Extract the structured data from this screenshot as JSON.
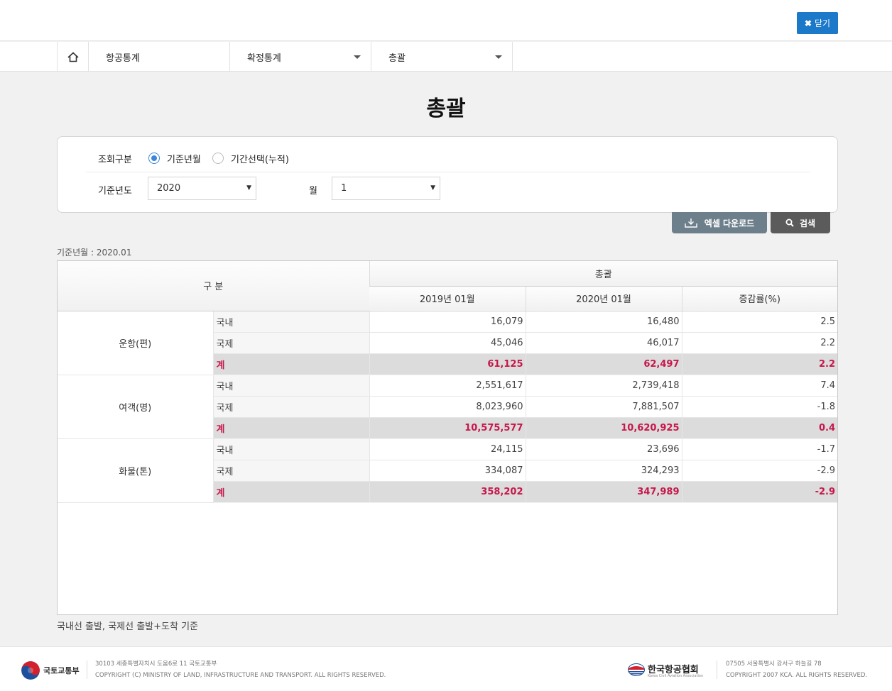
{
  "header": {
    "close_label": "닫기"
  },
  "nav": {
    "home_icon": "home-icon",
    "items": [
      {
        "label": "항공통계"
      },
      {
        "label": "확정통계"
      },
      {
        "label": "총괄"
      }
    ]
  },
  "page_title": "총괄",
  "filter": {
    "query_type_label": "조회구분",
    "options": [
      {
        "label": "기준년월",
        "checked": true
      },
      {
        "label": "기간선택(누적)",
        "checked": false
      }
    ],
    "year_label": "기준년도",
    "year_value": "2020",
    "month_label": "월",
    "month_value": "1"
  },
  "buttons": {
    "excel_label": "엑셀 다운로드",
    "search_label": "검색"
  },
  "base_month_label": "기준년월 : 2020.01",
  "table": {
    "header_category": "구 분",
    "header_group": "총괄",
    "header_cols": [
      "2019년 01월",
      "2020년 01월",
      "증감률(%)"
    ],
    "groups": [
      {
        "label": "운항(편)",
        "rows": [
          {
            "sub": "국내",
            "v2019": "16,079",
            "v2020": "16,480",
            "rate": "2.5"
          },
          {
            "sub": "국제",
            "v2019": "45,046",
            "v2020": "46,017",
            "rate": "2.2"
          },
          {
            "sub": "계",
            "v2019": "61,125",
            "v2020": "62,497",
            "rate": "2.2"
          }
        ]
      },
      {
        "label": "여객(명)",
        "rows": [
          {
            "sub": "국내",
            "v2019": "2,551,617",
            "v2020": "2,739,418",
            "rate": "7.4"
          },
          {
            "sub": "국제",
            "v2019": "8,023,960",
            "v2020": "7,881,507",
            "rate": "-1.8"
          },
          {
            "sub": "계",
            "v2019": "10,575,577",
            "v2020": "10,620,925",
            "rate": "0.4"
          }
        ]
      },
      {
        "label": "화물(톤)",
        "rows": [
          {
            "sub": "국내",
            "v2019": "24,115",
            "v2020": "23,696",
            "rate": "-1.7"
          },
          {
            "sub": "국제",
            "v2019": "334,087",
            "v2020": "324,293",
            "rate": "-2.9"
          },
          {
            "sub": "계",
            "v2019": "358,202",
            "v2020": "347,989",
            "rate": "-2.9"
          }
        ]
      }
    ]
  },
  "footnote": "국내선 출발, 국제선 출발+도착 기준",
  "footer": {
    "molit_name": "국토교통부",
    "molit_address": "30103 세종특별자치시 도움6로 11 국토교통부",
    "molit_copyright": "COPYRIGHT (C) MINISTRY OF LAND, INFRASTRUCTURE AND TRANSPORT. ALL RIGHTS RESERVED.",
    "kca_name": "한국항공협회",
    "kca_en": "Korea Civil Aviation Association",
    "kca_address": "07505 서울특별시 강서구 하늘길 78",
    "kca_copyright": "COPYRIGHT 2007 KCA. ALL RIGHTS RESERVED."
  },
  "colors": {
    "accent": "#1c78c8",
    "total_text": "#c6184b",
    "excel_button": "#6e7f8c",
    "search_button": "#5b5b5b"
  }
}
